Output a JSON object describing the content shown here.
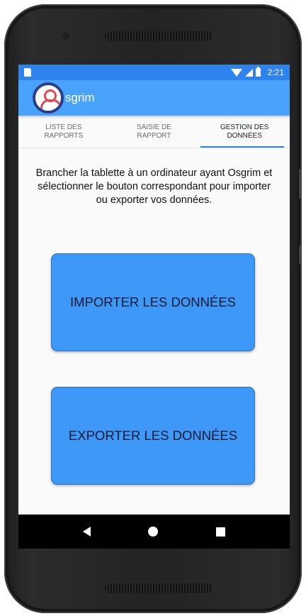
{
  "status_bar": {
    "time": "2:21"
  },
  "app_bar": {
    "title": "sgrim"
  },
  "tabs": [
    {
      "label": "LISTE DES RAPPORTS",
      "active": false
    },
    {
      "label": "SAISIE DE RAPPORT",
      "active": false
    },
    {
      "label": "GESTION DES DONNÉES",
      "active": true
    }
  ],
  "main": {
    "instructions": "Brancher la tablette à un ordinateur ayant Osgrim et sélectionner le bouton correspondant pour importer ou exporter vos données.",
    "import_label": "IMPORTER LES DONNÉES",
    "export_label": "EXPORTER LES DONNÉES"
  },
  "icons": {
    "sd_card": "sd-card-icon",
    "wifi": "wifi-icon",
    "signal": "cell-signal-icon",
    "battery": "battery-icon",
    "back": "back-icon",
    "home": "home-icon",
    "recents": "recents-icon"
  },
  "colors": {
    "status_bar": "#2f83ee",
    "app_bar": "#4aa3fb",
    "button": "#3d98f7",
    "tab_indicator": "#2f83ee"
  }
}
